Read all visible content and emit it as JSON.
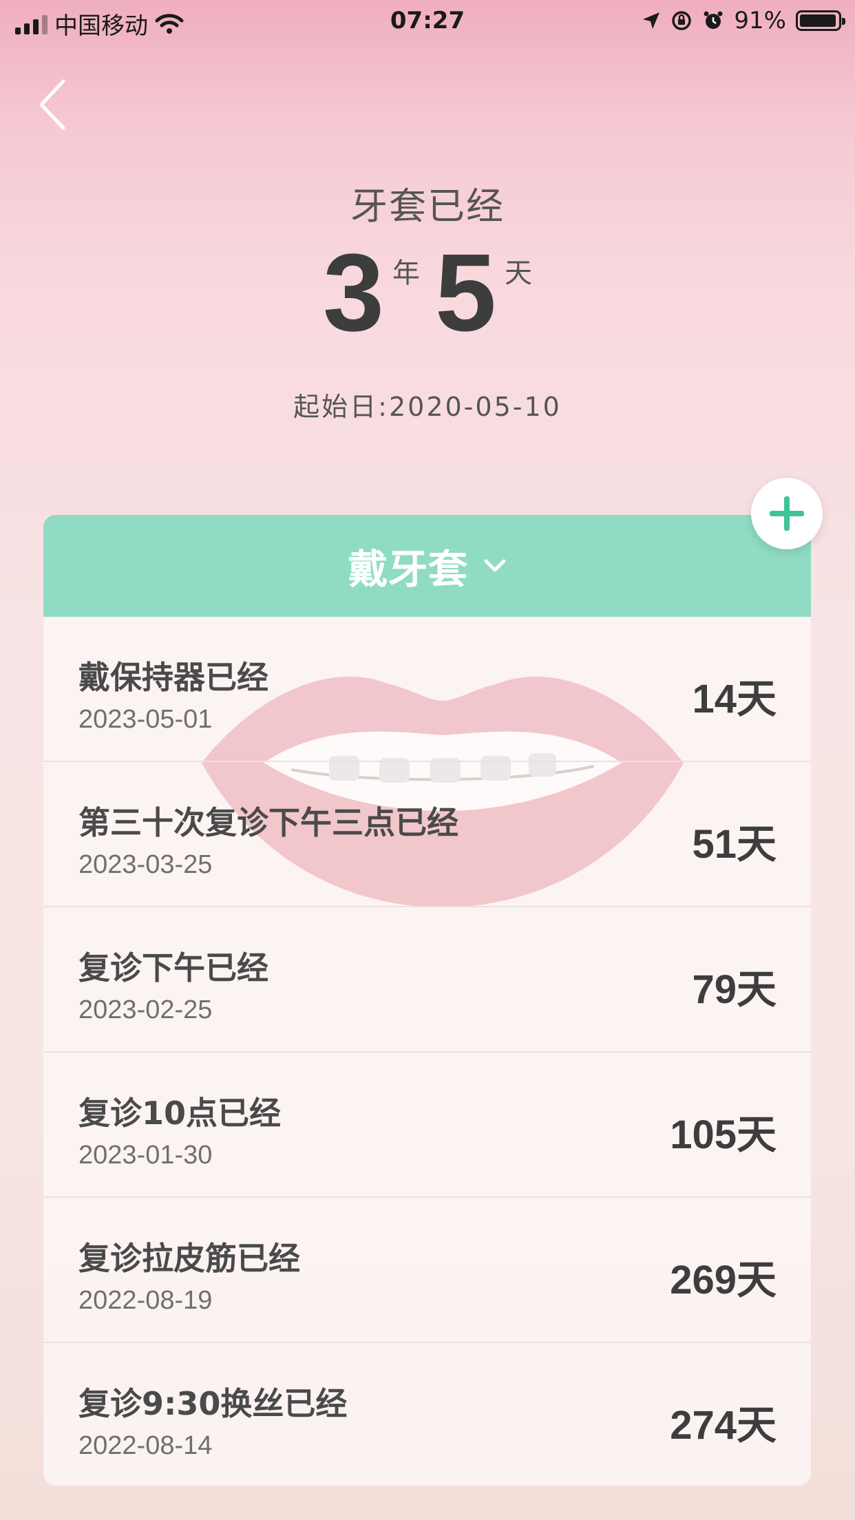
{
  "status_bar": {
    "carrier": "中国移动",
    "time": "07:27",
    "battery": "91%",
    "icons": [
      "signal-icon",
      "wifi-icon",
      "location-icon",
      "rotation-lock-icon",
      "alarm-icon",
      "battery-icon"
    ]
  },
  "header": {
    "title": "牙套已经",
    "years": "3",
    "years_unit": "年",
    "days": "5",
    "days_unit": "天",
    "start_date": "起始日:2020-05-10"
  },
  "card": {
    "header_label": "戴牙套",
    "accent_color": "#8fdbc4",
    "items": [
      {
        "title": "戴保持器已经",
        "date": "2023-05-01",
        "days": "14天"
      },
      {
        "title": "第三十次复诊下午三点已经",
        "date": "2023-03-25",
        "days": "51天"
      },
      {
        "title": "复诊下午已经",
        "date": "2023-02-25",
        "days": "79天"
      },
      {
        "title": "复诊10点已经",
        "date": "2023-01-30",
        "days": "105天"
      },
      {
        "title": "复诊拉皮筋已经",
        "date": "2022-08-19",
        "days": "269天"
      },
      {
        "title": "复诊9:30换丝已经",
        "date": "2022-08-14",
        "days": "274天"
      }
    ]
  },
  "colors": {
    "add_button_plus": "#3fc493",
    "background_top": "#efaec0",
    "background_bottom": "#f3ded9"
  }
}
